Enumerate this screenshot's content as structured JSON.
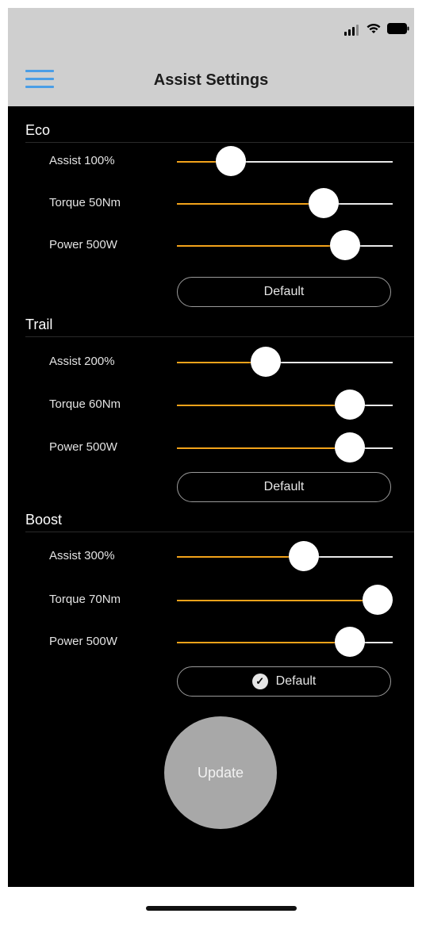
{
  "nav": {
    "title": "Assist Settings"
  },
  "sections": [
    {
      "title": "Eco",
      "sliders": [
        {
          "label": "Assist 100%",
          "value": 0.25
        },
        {
          "label": "Torque 50Nm",
          "value": 0.68
        },
        {
          "label": "Power 500W",
          "value": 0.78
        }
      ],
      "default_label": "Default",
      "default_checked": false
    },
    {
      "title": "Trail",
      "sliders": [
        {
          "label": "Assist 200%",
          "value": 0.41
        },
        {
          "label": "Torque 60Nm",
          "value": 0.8
        },
        {
          "label": "Power 500W",
          "value": 0.8
        }
      ],
      "default_label": "Default",
      "default_checked": false
    },
    {
      "title": "Boost",
      "sliders": [
        {
          "label": "Assist 300%",
          "value": 0.59
        },
        {
          "label": "Torque 70Nm",
          "value": 0.93
        },
        {
          "label": "Power 500W",
          "value": 0.8
        }
      ],
      "default_label": "Default",
      "default_checked": true
    }
  ],
  "update_label": "Update",
  "colors": {
    "accent": "#f2a21a",
    "nav_bg": "#cfcfcf",
    "menu_icon": "#4a9ee6"
  },
  "icons": {
    "menu": "hamburger-menu-icon",
    "signal": "cellular-signal-icon",
    "wifi": "wifi-icon",
    "battery": "battery-icon",
    "check": "checkmark-circle-icon"
  }
}
